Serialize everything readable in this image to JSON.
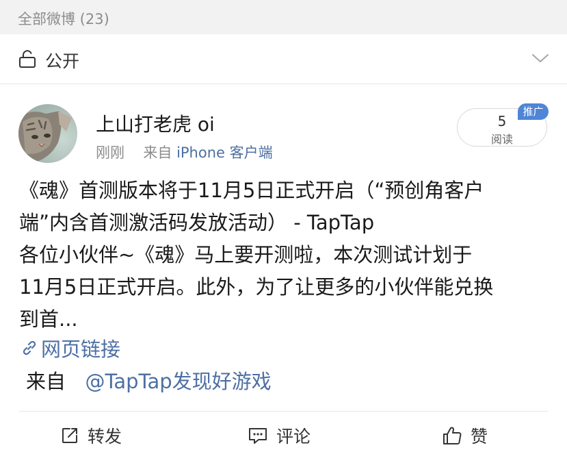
{
  "section_header": {
    "title": "全部微博 (23)"
  },
  "visibility": {
    "label": "公开",
    "lock_icon": "lock-open-icon",
    "chevron_icon": "chevron-down-icon"
  },
  "post": {
    "username": "上山打老虎 oi",
    "time": "刚刚",
    "source_prefix": "来自",
    "source": "iPhone 客户端",
    "reads": {
      "count": "5",
      "label": "阅读"
    },
    "promo_badge": "推广",
    "text_lines": [
      "《魂》首测版本将于11月5日正式开启（“预创角客户",
      "端”内含首测激活码发放活动） - TapTap",
      "各位小伙伴~《魂》马上要开测啦，本次测试计划于",
      "11月5日正式开启。此外，为了让更多的小伙伴能兑换",
      "到首..."
    ],
    "web_link": "网页链接",
    "via_prefix": "来自",
    "via_mention": "@TapTap发现好游戏"
  },
  "actions": {
    "repost": "转发",
    "comment": "评论",
    "like": "赞"
  },
  "colors": {
    "link": "#4d6fa3",
    "badge": "#4f85d6",
    "header_bg": "#f2f2f2",
    "muted_text": "#8c8c8c"
  }
}
